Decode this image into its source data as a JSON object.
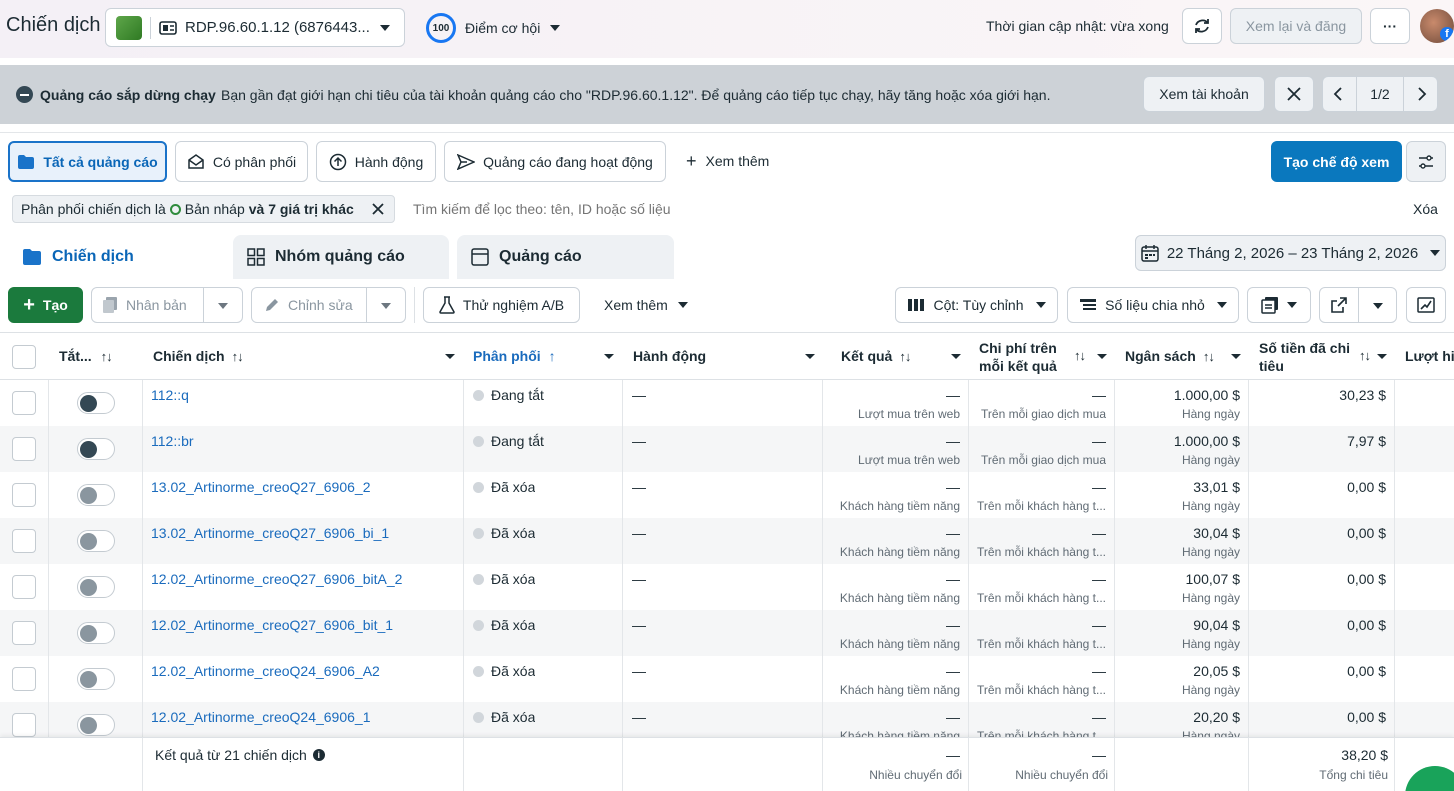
{
  "topbar": {
    "title": "Chiến dịch",
    "account_name": "RDP.96.60.1.12 (6876443...",
    "score_badge": "100",
    "opportunity_label": "Điểm cơ hội",
    "update_time": "Thời gian cập nhật: vừa xong",
    "review_publish": "Xem lại và đăng",
    "more": "···"
  },
  "banner": {
    "title": "Quảng cáo sắp dừng chạy",
    "message": "Bạn gần đạt giới hạn chi tiêu của tài khoản quảng cáo cho \"RDP.96.60.1.12\". Để quảng cáo tiếp tục chạy, hãy tăng hoặc xóa giới hạn.",
    "view_account": "Xem tài khoản",
    "pager": "1/2"
  },
  "filters": {
    "all_ads": "Tất cả quảng cáo",
    "delivering": "Có phân phối",
    "actions": "Hành động",
    "active_ads": "Quảng cáo đang hoạt động",
    "see_more": "Xem thêm",
    "create_view": "Tạo chế độ xem"
  },
  "search": {
    "chip_prefix": "Phân phối chiến dịch là",
    "chip_value": "Bản nháp",
    "chip_suffix": "và 7 giá trị khác",
    "placeholder": "Tìm kiếm để lọc theo: tên, ID hoặc số liệu",
    "clear": "Xóa"
  },
  "tabs": {
    "campaigns": "Chiến dịch",
    "adsets": "Nhóm quảng cáo",
    "ads": "Quảng cáo",
    "date_range": "22 Tháng 2, 2026 – 23 Tháng 2, 2026"
  },
  "toolbar": {
    "create": "Tạo",
    "duplicate": "Nhân bản",
    "edit": "Chỉnh sửa",
    "ab_test": "Thử nghiệm A/B",
    "see_more": "Xem thêm",
    "columns": "Cột: Tùy chỉnh",
    "breakdown": "Số liệu chia nhỏ"
  },
  "table": {
    "headers": {
      "toggle": "Tắt...",
      "campaign": "Chiến dịch",
      "delivery": "Phân phối",
      "actions": "Hành động",
      "results": "Kết quả",
      "cost_line1": "Chi phí trên",
      "cost_line2": "mỗi kết quả",
      "budget": "Ngân sách",
      "spent_line1": "Số tiền đã chi",
      "spent_line2": "tiêu",
      "reach": "Lượt hi"
    },
    "rows": [
      {
        "name": "112::q",
        "status": "Đang tắt",
        "action": "—",
        "result": "—",
        "result_sub": "Lượt mua trên web",
        "cost": "—",
        "cost_sub": "Trên mỗi giao dịch mua",
        "budget": "1.000,00 $",
        "budget_sub": "Hàng ngày",
        "spent": "30,23 $"
      },
      {
        "name": "112::br",
        "status": "Đang tắt",
        "action": "—",
        "result": "—",
        "result_sub": "Lượt mua trên web",
        "cost": "—",
        "cost_sub": "Trên mỗi giao dịch mua",
        "budget": "1.000,00 $",
        "budget_sub": "Hàng ngày",
        "spent": "7,97 $"
      },
      {
        "name": "13.02_Artinorme_creoQ27_6906_2",
        "status": "Đã xóa",
        "action": "—",
        "result": "—",
        "result_sub": "Khách hàng tiềm năng",
        "cost": "—",
        "cost_sub": "Trên mỗi khách hàng t...",
        "budget": "33,01 $",
        "budget_sub": "Hàng ngày",
        "spent": "0,00 $"
      },
      {
        "name": "13.02_Artinorme_creoQ27_6906_bi_1",
        "status": "Đã xóa",
        "action": "—",
        "result": "—",
        "result_sub": "Khách hàng tiềm năng",
        "cost": "—",
        "cost_sub": "Trên mỗi khách hàng t...",
        "budget": "30,04 $",
        "budget_sub": "Hàng ngày",
        "spent": "0,00 $"
      },
      {
        "name": "12.02_Artinorme_creoQ27_6906_bitA_2",
        "status": "Đã xóa",
        "action": "—",
        "result": "—",
        "result_sub": "Khách hàng tiềm năng",
        "cost": "—",
        "cost_sub": "Trên mỗi khách hàng t...",
        "budget": "100,07 $",
        "budget_sub": "Hàng ngày",
        "spent": "0,00 $"
      },
      {
        "name": "12.02_Artinorme_creoQ27_6906_bit_1",
        "status": "Đã xóa",
        "action": "—",
        "result": "—",
        "result_sub": "Khách hàng tiềm năng",
        "cost": "—",
        "cost_sub": "Trên mỗi khách hàng t...",
        "budget": "90,04 $",
        "budget_sub": "Hàng ngày",
        "spent": "0,00 $"
      },
      {
        "name": "12.02_Artinorme_creoQ24_6906_A2",
        "status": "Đã xóa",
        "action": "—",
        "result": "—",
        "result_sub": "Khách hàng tiềm năng",
        "cost": "—",
        "cost_sub": "Trên mỗi khách hàng t...",
        "budget": "20,05 $",
        "budget_sub": "Hàng ngày",
        "spent": "0,00 $"
      },
      {
        "name": "12.02_Artinorme_creoQ24_6906_1",
        "status": "Đã xóa",
        "action": "—",
        "result": "—",
        "result_sub": "Khách hàng tiềm năng",
        "cost": "—",
        "cost_sub": "Trên mỗi khách hàng t...",
        "budget": "20,20 $",
        "budget_sub": "Hàng ngày",
        "spent": "0,00 $"
      }
    ],
    "footer": {
      "label": "Kết quả từ 21 chiến dịch",
      "result": "—",
      "result_sub": "Nhiều chuyển đổi",
      "cost": "—",
      "cost_sub": "Nhiều chuyển đổi",
      "spent": "38,20 $",
      "spent_sub": "Tổng chi tiêu"
    }
  },
  "colors": {
    "primary": "#0a78be",
    "link": "#1a6bbd",
    "create": "#1b7a3d"
  }
}
